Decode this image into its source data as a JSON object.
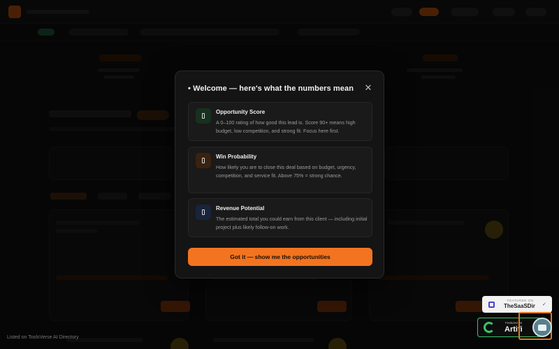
{
  "modal": {
    "title": "• Welcome — here's what the numbers mean",
    "close_label": "✕",
    "cards": [
      {
        "icon": "score-icon",
        "icon_color": "#17301f",
        "heading": "Opportunity Score",
        "description": "A 0–100 rating of how good this lead is. Score 90+ means high budget, low competition, and strong fit. Focus here first."
      },
      {
        "icon": "probability-icon",
        "icon_color": "#3a2210",
        "heading": "Win Probability",
        "description": "How likely you are to close this deal based on budget, urgency, competition, and service fit. Above 75% = strong chance."
      },
      {
        "icon": "revenue-icon",
        "icon_color": "#18243a",
        "heading": "Revenue Potential",
        "description": "The estimated total you could earn from this client — including initial project plus likely follow-on work."
      }
    ],
    "cta_label": "Got it — show me the opportunities"
  },
  "footer": {
    "listed_text": "Listed on ToolsVerse AI Directory"
  },
  "badges": {
    "saas_featured": "FEATURED ON",
    "saas_name": "TheSaaSDir",
    "saas_check": "✓",
    "arti_featured": "Featured on",
    "arti_name": "Artifi"
  },
  "colors": {
    "accent": "#f27420",
    "modal_bg": "#141414",
    "card_bg": "#1a1a1a"
  }
}
